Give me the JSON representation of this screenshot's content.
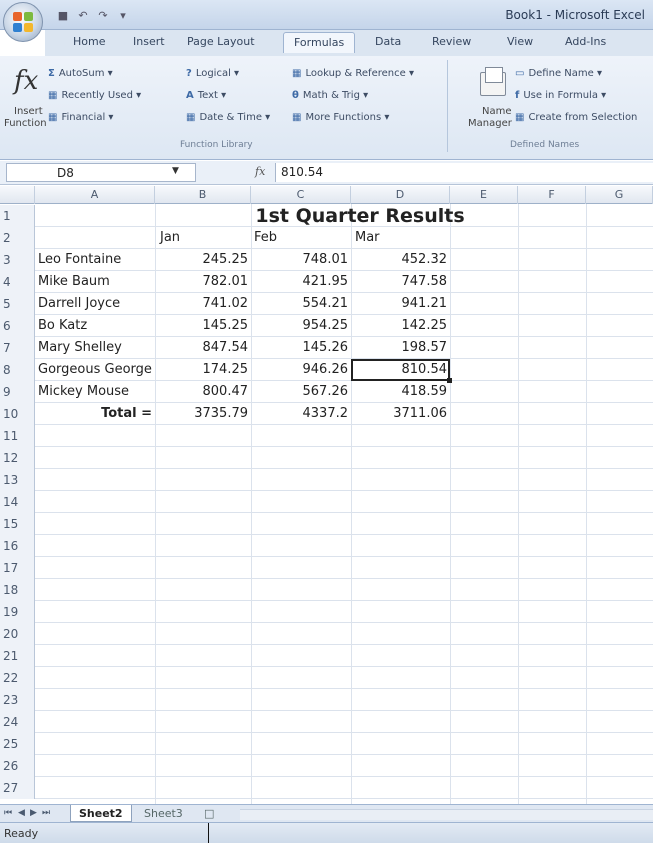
{
  "window": {
    "title": "Book1 - Microsoft Excel",
    "qat": [
      "save-icon",
      "undo-icon",
      "redo-icon",
      "customize-icon"
    ]
  },
  "ribbon": {
    "tabs": [
      "Home",
      "Insert",
      "Page Layout",
      "Formulas",
      "Data",
      "Review",
      "View",
      "Add-Ins"
    ],
    "active_tab": "Formulas",
    "insert_function": [
      "Insert",
      "Function"
    ],
    "function_library": {
      "caption": "Function Library",
      "col1": [
        "AutoSum",
        "Recently Used",
        "Financial"
      ],
      "col2": [
        "Logical",
        "Text",
        "Date & Time"
      ],
      "col3": [
        "Lookup & Reference",
        "Math & Trig",
        "More Functions"
      ]
    },
    "defined_names": {
      "caption": "Defined Names",
      "name_manager": [
        "Name",
        "Manager"
      ],
      "items": [
        "Define Name",
        "Use in Formula",
        "Create from Selection"
      ]
    }
  },
  "formula_bar": {
    "name_box": "D8",
    "formula": "810.54"
  },
  "grid": {
    "columns": [
      "A",
      "B",
      "C",
      "D",
      "E",
      "F",
      "G"
    ],
    "row_numbers": [
      "1",
      "2",
      "3",
      "4",
      "5",
      "6",
      "7",
      "8",
      "9",
      "10",
      "11",
      "12",
      "13",
      "14",
      "15",
      "16",
      "17",
      "18",
      "19",
      "20",
      "21",
      "22",
      "23",
      "24",
      "25",
      "26",
      "27"
    ],
    "title": "1st Quarter Results",
    "months": [
      "Jan",
      "Feb",
      "Mar"
    ],
    "data": [
      [
        "Leo Fontaine",
        "245.25",
        "748.01",
        "452.32"
      ],
      [
        "Mike Baum",
        "782.01",
        "421.95",
        "747.58"
      ],
      [
        "Darrell Joyce",
        "741.02",
        "554.21",
        "941.21"
      ],
      [
        "Bo Katz",
        "145.25",
        "954.25",
        "142.25"
      ],
      [
        "Mary Shelley",
        "847.54",
        "145.26",
        "198.57"
      ],
      [
        "Gorgeous George",
        "174.25",
        "946.26",
        "810.54"
      ],
      [
        "Mickey Mouse",
        "800.47",
        "567.26",
        "418.59"
      ]
    ],
    "total": [
      "Total =",
      "3735.79",
      "4337.2",
      "3711.06"
    ],
    "selected_cell": "D8"
  },
  "sheets": {
    "tabs": [
      "Sheet2",
      "Sheet3"
    ],
    "active": "Sheet2"
  },
  "status": "Ready"
}
